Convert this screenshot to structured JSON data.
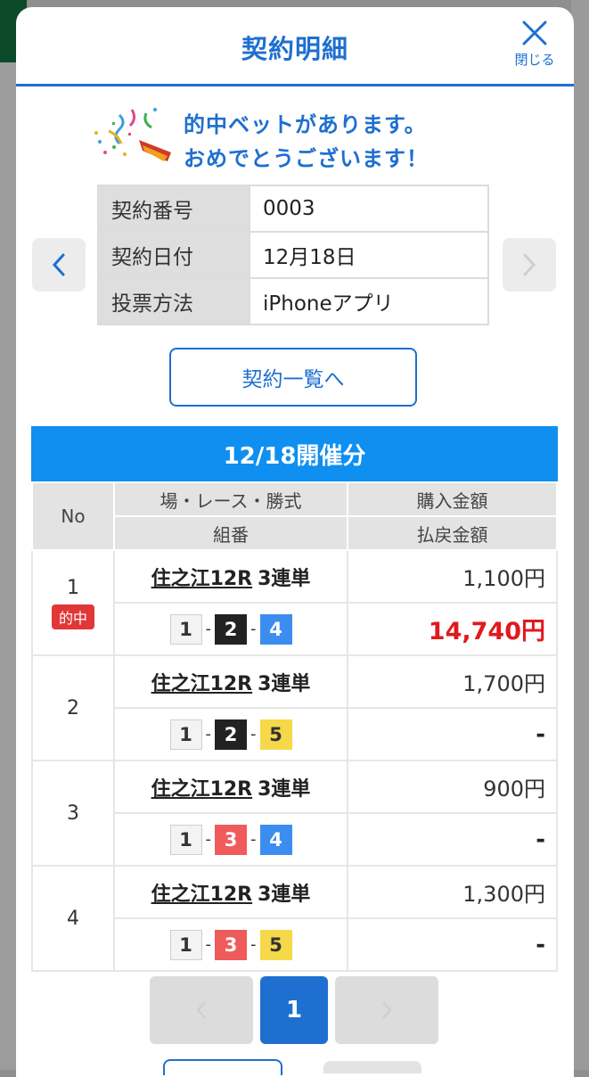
{
  "header": {
    "title": "契約明細",
    "close_label": "閉じる"
  },
  "congrats": {
    "line1": "的中ベットがあります。",
    "line2": "おめでとうございます！"
  },
  "contract": {
    "rows": [
      {
        "label": "契約番号",
        "value": "0003"
      },
      {
        "label": "契約日付",
        "value": "12月18日"
      },
      {
        "label": "投票方法",
        "value": "iPhoneアプリ"
      }
    ]
  },
  "list_button": "契約一覧へ",
  "section_title": "12/18開催分",
  "table": {
    "col_no": "No",
    "col_race": "場・レース・勝式",
    "col_combo": "組番",
    "col_purchase": "購入金額",
    "col_payout": "払戻金額"
  },
  "bets": [
    {
      "no": "1",
      "hit": "的中",
      "venue": "住之江12R",
      "type": "3連単",
      "combo": [
        "1",
        "2",
        "4"
      ],
      "purchase": "1,100円",
      "payout": "14,740円"
    },
    {
      "no": "2",
      "hit": "",
      "venue": "住之江12R",
      "type": "3連単",
      "combo": [
        "1",
        "2",
        "5"
      ],
      "purchase": "1,700円",
      "payout": "-"
    },
    {
      "no": "3",
      "hit": "",
      "venue": "住之江12R",
      "type": "3連単",
      "combo": [
        "1",
        "3",
        "4"
      ],
      "purchase": "900円",
      "payout": "-"
    },
    {
      "no": "4",
      "hit": "",
      "venue": "住之江12R",
      "type": "3連単",
      "combo": [
        "1",
        "3",
        "5"
      ],
      "purchase": "1,300円",
      "payout": "-"
    }
  ],
  "combo_dash": "-",
  "pager": {
    "current": "1"
  },
  "colors": {
    "accent": "#1e6fd0",
    "section": "#0f8ff0",
    "win": "#e0191e"
  }
}
